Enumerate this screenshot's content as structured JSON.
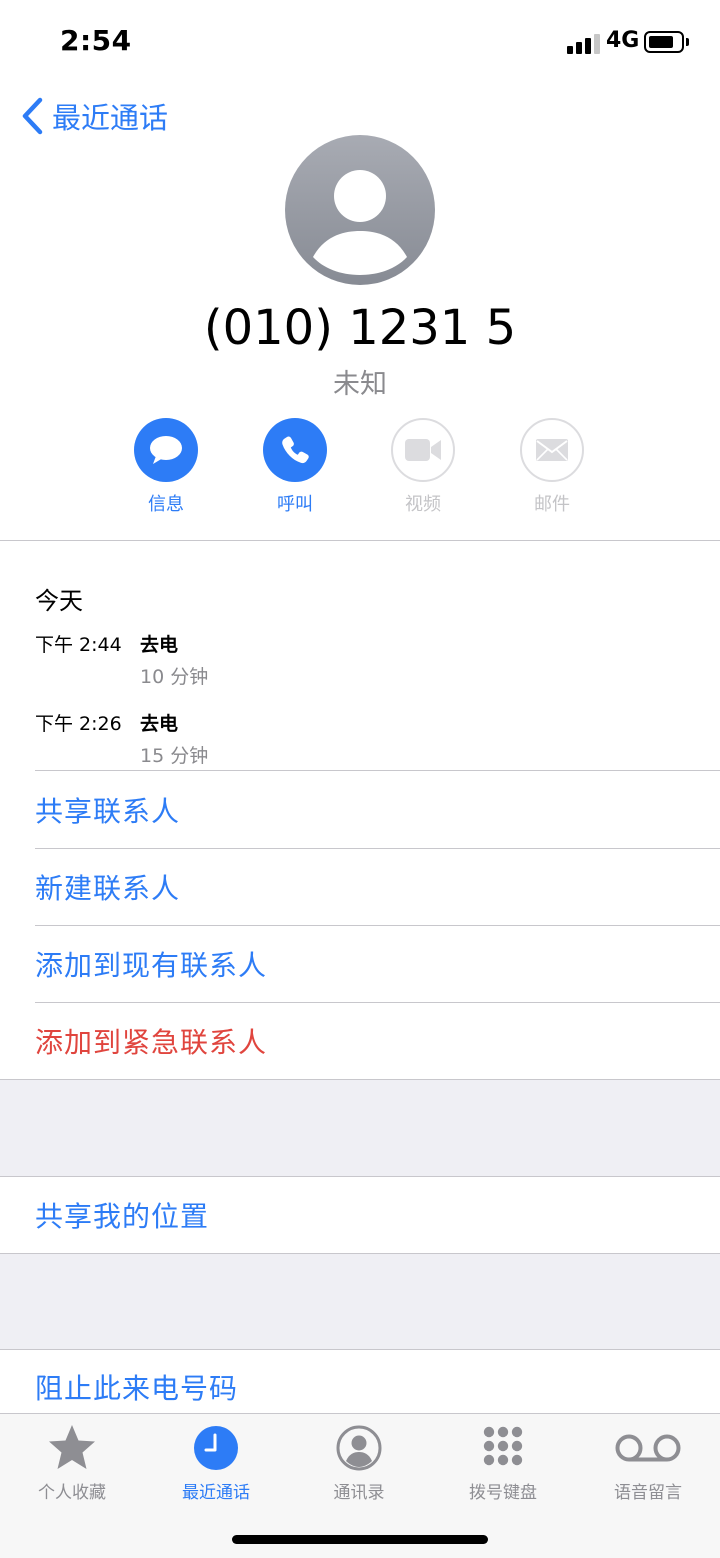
{
  "status_bar": {
    "time": "2:54",
    "network": "4G",
    "battery_level": 0.8
  },
  "nav": {
    "back_label": "最近通话"
  },
  "contact": {
    "number": "(010) 1231 5",
    "label": "未知"
  },
  "actions": [
    {
      "label": "信息",
      "icon": "message-icon",
      "enabled": true
    },
    {
      "label": "呼叫",
      "icon": "phone-icon",
      "enabled": true
    },
    {
      "label": "视频",
      "icon": "video-icon",
      "enabled": false
    },
    {
      "label": "邮件",
      "icon": "mail-icon",
      "enabled": false
    }
  ],
  "call_log": {
    "date": "今天",
    "entries": [
      {
        "time": "下午 2:44",
        "type": "去电",
        "duration": "10 分钟"
      },
      {
        "time": "下午 2:26",
        "type": "去电",
        "duration": "15 分钟"
      }
    ]
  },
  "options_group1": [
    "共享联系人",
    "新建联系人",
    "添加到现有联系人",
    "添加到紧急联系人"
  ],
  "options_group2": [
    "共享我的位置"
  ],
  "options_group3": [
    "阻止此来电号码"
  ],
  "tabbar": {
    "active_index": 1,
    "items": [
      {
        "label": "个人收藏",
        "icon": "star-icon"
      },
      {
        "label": "最近通话",
        "icon": "clock-icon"
      },
      {
        "label": "通讯录",
        "icon": "contact-icon"
      },
      {
        "label": "拨号键盘",
        "icon": "keypad-icon"
      },
      {
        "label": "语音留言",
        "icon": "voicemail-icon"
      }
    ]
  },
  "colors": {
    "accent": "#2d7cf6",
    "destructive": "#e0453e",
    "secondary_text": "#8a8a8e"
  }
}
